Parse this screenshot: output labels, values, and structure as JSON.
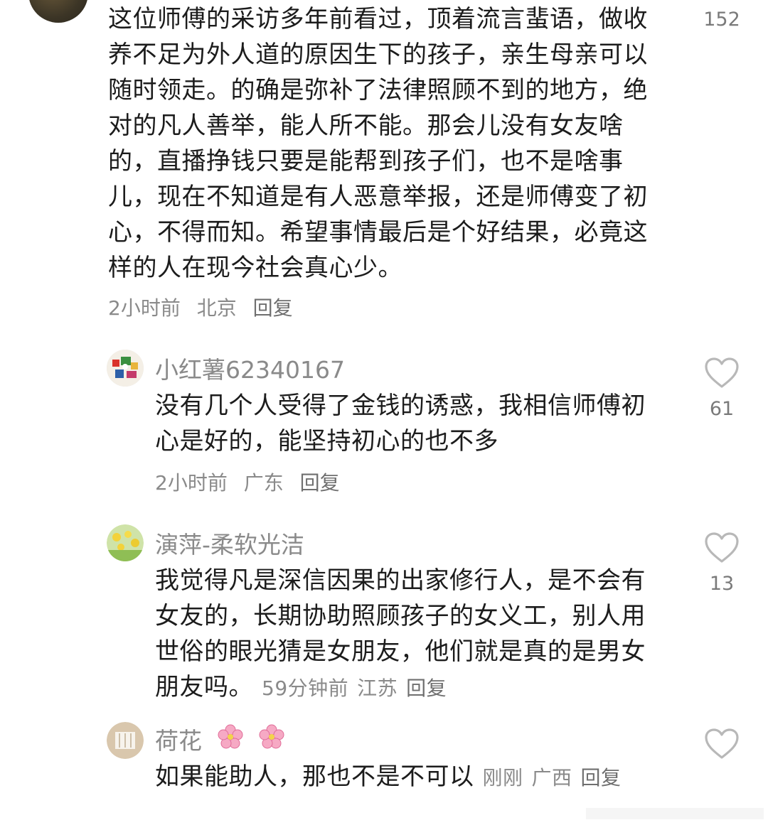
{
  "comments": [
    {
      "text": "这位师傅的采访多年前看过，顶着流言蜚语，做收养不足为外人道的原因生下的孩子，亲生母亲可以随时领走。的确是弥补了法律照顾不到的地方，绝对的凡人善举，能人所不能。那会儿没有女友啥的，直播挣钱只要是能帮到孩子们，也不是啥事儿，现在不知道是有人恶意举报，还是师傅变了初心，不得而知。希望事情最后是个好结果，必竟这样的人在现今社会真心少。",
      "time": "2小时前",
      "location": "北京",
      "reply": "回复",
      "likes": "152"
    }
  ],
  "replies": [
    {
      "username": "小红薯62340167",
      "text": "没有几个人受得了金钱的诱惑，我相信师傅初心是好的，能坚持初心的也不多",
      "time": "2小时前",
      "location": "广东",
      "reply": "回复",
      "likes": "61"
    },
    {
      "username": "演萍-柔软光洁",
      "text": "我觉得凡是深信因果的出家修行人，是不会有女友的，长期协助照顾孩子的女义工，别人用世俗的眼光猜是女朋友，他们就是真的是男女朋友吗。",
      "time": "59分钟前",
      "location": "江苏",
      "reply": "回复",
      "likes": "13"
    },
    {
      "username": "荷花",
      "username_emoji": "🌸 🌸",
      "text": "如果能助人，那也不是不可以",
      "time": "刚刚",
      "location": "广西",
      "reply": "回复",
      "likes": ""
    }
  ],
  "colors": {
    "text": "#1c1c1c",
    "meta": "#8a8a8a",
    "heart": "#b8b8b8"
  },
  "icons": [
    "heart-icon",
    "cherry-blossom-icon"
  ]
}
